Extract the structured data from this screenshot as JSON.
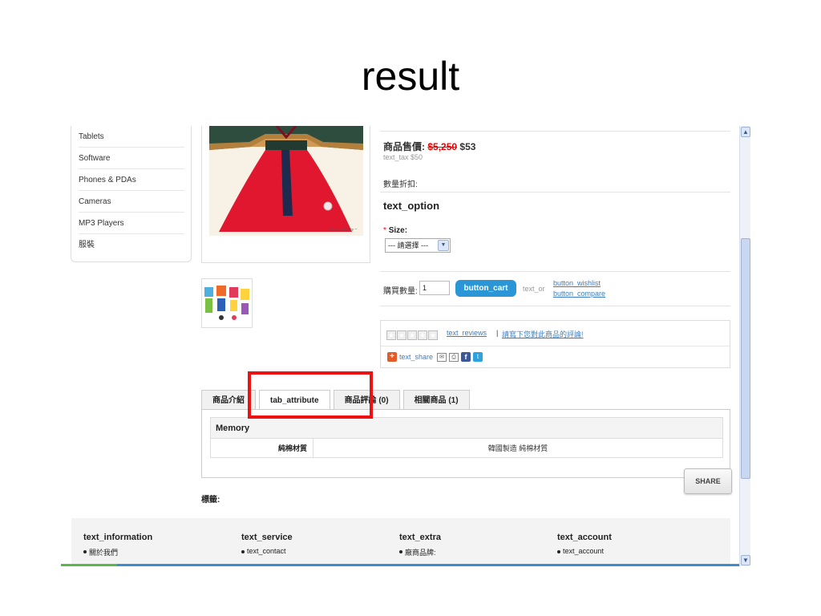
{
  "slide_title": "result",
  "categories": [
    "Tablets",
    "Software",
    "Phones & PDAs",
    "Cameras",
    "MP3 Players",
    "服裝"
  ],
  "product": {
    "price_label": "商品售價:",
    "price_old": "$5,250",
    "price_new": "$53",
    "tax": "text_tax $50",
    "discount_label": "數量折扣:",
    "option_title": "text_option",
    "size_required_mark": "*",
    "size_label": "Size:",
    "size_select_value": "--- 請選擇 ---",
    "qty_label": "購買數量:",
    "qty_value": "1",
    "cart_button": "button_cart",
    "text_or": "text_or",
    "wishlist_link": "button_wishlist",
    "compare_link": "button_compare"
  },
  "reviews": {
    "reviews_link": "text_reviews",
    "separator": "|",
    "write_link": "請寫下您對此商品的評論!",
    "share_text": "text_share"
  },
  "tabs": [
    {
      "label": "商品介紹",
      "active": false
    },
    {
      "label": "tab_attribute",
      "active": true
    },
    {
      "label": "商品評論 (0)",
      "active": false
    },
    {
      "label": "相關商品 (1)",
      "active": false
    }
  ],
  "attributes": {
    "group": "Memory",
    "rows": [
      {
        "name": "純棉材質",
        "value": "韓國製造 純棉材質"
      }
    ]
  },
  "share_button": "SHARE",
  "tags_label": "標籤:",
  "footer": [
    {
      "title": "text_information",
      "item": "關於我們"
    },
    {
      "title": "text_service",
      "item": "text_contact"
    },
    {
      "title": "text_extra",
      "item": "廠商品牌:"
    },
    {
      "title": "text_account",
      "item": "text_account"
    }
  ],
  "colors": {
    "highlight": "#ee1111",
    "cart_button": "#2a96d6",
    "price_old": "#e00000",
    "link": "#3a7fc4"
  },
  "icons": {
    "share_plus": "+",
    "facebook": "f",
    "twitter": "t",
    "scroll_up": "▲",
    "scroll_down": "▼",
    "select_arrow": "▼"
  }
}
